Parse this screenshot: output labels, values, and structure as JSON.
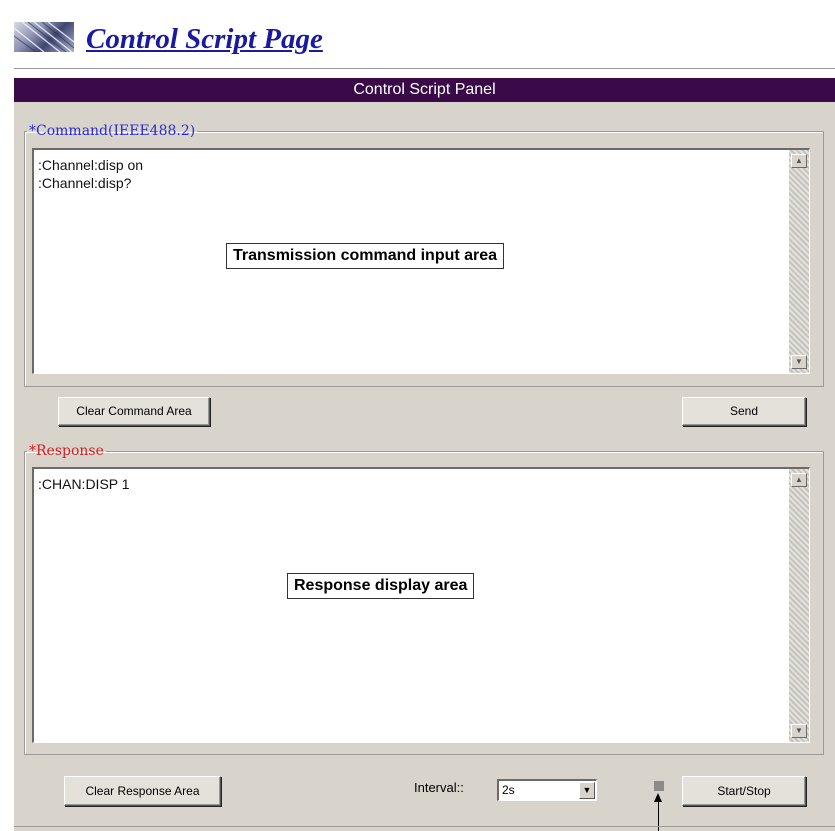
{
  "page": {
    "title": "Control Script Page"
  },
  "panel": {
    "header": "Control Script Panel"
  },
  "command": {
    "legend": "*Command(IEEE488.2)",
    "text": ":Channel:disp on\n:Channel:disp?",
    "annotation": "Transmission command input area",
    "clear_label": "Clear Command Area",
    "send_label": "Send"
  },
  "response": {
    "legend": "*Response",
    "text": ":CHAN:DISP 1",
    "annotation": "Response display area",
    "clear_label": "Clear Response Area"
  },
  "controls": {
    "interval_label": "Interval::",
    "interval_value": "2s",
    "start_stop_label": "Start/Stop"
  },
  "colors": {
    "header_bg": "#3a0a48",
    "command_legend": "#2a2ad0",
    "response_legend": "#d02020",
    "title": "#1a1aa0"
  }
}
